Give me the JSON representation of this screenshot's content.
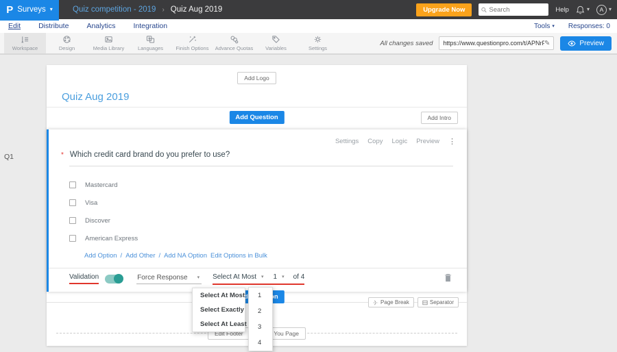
{
  "colors": {
    "accent_blue": "#1b87e6",
    "upgrade_orange": "#faa21b",
    "toggle_teal": "#2a9d94",
    "annotation_red": "#e0362c",
    "nav_blue": "#26458c",
    "title_blue": "#4a9ede"
  },
  "topbar": {
    "logo_letter": "P",
    "product_label": "Surveys",
    "caret": "▾",
    "breadcrumb_parent": "Quiz competition - 2019",
    "breadcrumb_separator": "›",
    "breadcrumb_current": "Quiz Aug 2019",
    "upgrade_label": "Upgrade Now",
    "search_placeholder": "Search",
    "help_label": "Help",
    "avatar_initial": "A"
  },
  "nav": {
    "items": [
      "Edit",
      "Distribute",
      "Analytics",
      "Integration"
    ],
    "tools_label": "Tools",
    "caret": "▾",
    "responses_label": "Responses: 0"
  },
  "toolbar": {
    "items": [
      "Workspace",
      "Design",
      "Media Library",
      "Languages",
      "Finish Options",
      "Advance Quotas",
      "Variables",
      "Settings"
    ],
    "saved_status": "All changes saved",
    "url_value": "https://www.questionpro.com/t/APNrFZ",
    "preview_label": "Preview"
  },
  "survey": {
    "add_logo_label": "Add Logo",
    "title": "Quiz Aug 2019",
    "add_question_label": "Add Question",
    "add_intro_label": "Add Intro",
    "question": {
      "id_label": "Q1",
      "action_settings": "Settings",
      "action_copy": "Copy",
      "action_logic": "Logic",
      "action_preview": "Preview",
      "kebab": "⋮",
      "required_marker": "*",
      "text": "Which credit card brand do you prefer to use?",
      "options": [
        "Mastercard",
        "Visa",
        "Discover",
        "American Express"
      ],
      "link_add_option": "Add Option",
      "link_separator": "/",
      "link_add_other": "Add Other",
      "link_add_na": "Add NA Option",
      "bulk_edit_label": "Edit Options in Bulk",
      "validation_label": "Validation",
      "force_response_label": "Force Response",
      "caret": "▾",
      "validation_type_value": "Select At Most",
      "validation_count_value": "1",
      "of_total_label": "of 4"
    },
    "footer": {
      "add_question_label": "Add Question",
      "page_break_label": "Page Break",
      "separator_label": "Separator",
      "edit_footer_label": "Edit Footer",
      "thank_you_label": "Thank You Page"
    }
  },
  "dropdowns": {
    "validation_type_options": [
      "Select At Most",
      "Select Exactly",
      "Select At Least"
    ],
    "count_options": [
      "1",
      "2",
      "3",
      "4"
    ]
  }
}
